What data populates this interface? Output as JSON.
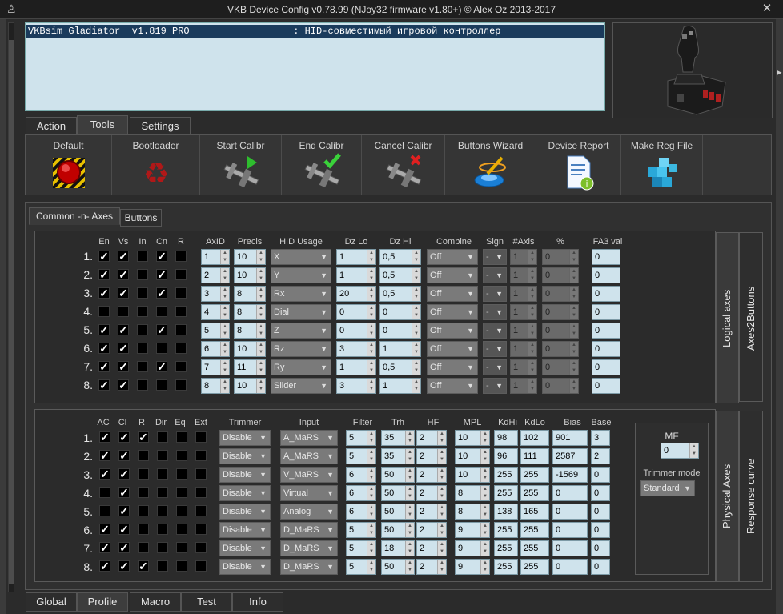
{
  "window": {
    "title": "VKB Device Config v0.78.99 (NJoy32 firmware v1.80+) © Alex Oz 2013-2017",
    "minimize": "—",
    "close": "✕"
  },
  "device": {
    "row": "VKBsim Gladiator  v1.819 PRO                  : HID-совместимый игровой контроллер"
  },
  "top_tabs": [
    "Action",
    "Tools",
    "Settings"
  ],
  "toolbar": [
    {
      "label": "Default",
      "icon": "red-button-icon"
    },
    {
      "label": "Bootloader",
      "icon": "recycle-icon"
    },
    {
      "label": "Start Calibr",
      "icon": "caliper-play-icon"
    },
    {
      "label": "End Calibr",
      "icon": "caliper-check-icon"
    },
    {
      "label": "Cancel Calibr",
      "icon": "caliper-cancel-icon"
    },
    {
      "label": "Buttons Wizard",
      "icon": "wizard-icon"
    },
    {
      "label": "Device Report",
      "icon": "report-icon"
    },
    {
      "label": "Make Reg File",
      "icon": "registry-icon"
    }
  ],
  "sub_tabs": [
    "Common -n- Axes",
    "Buttons"
  ],
  "logical": {
    "side_labels": [
      "Logical axes",
      "Axes2Buttons"
    ],
    "headers": {
      "en": "En",
      "vs": "Vs",
      "in": "In",
      "cn": "Cn",
      "r": "R",
      "axid": "AxID",
      "precis": "Precis",
      "hid": "HID Usage",
      "dzlo": "Dz Lo",
      "dzhi": "Dz Hi",
      "combine": "Combine",
      "sign": "Sign",
      "naxis": "#Axis",
      "pct": "%",
      "fa3": "FA3 val"
    },
    "rows": [
      {
        "n": "1.",
        "en": true,
        "vs": true,
        "in": false,
        "cn": true,
        "r": false,
        "axid": "1",
        "precis": "10",
        "hid": "X",
        "dzlo": "1",
        "dzhi": "0,5",
        "combine": "Off",
        "sign": "-",
        "naxis": "1",
        "pct": "0",
        "fa3": "0"
      },
      {
        "n": "2.",
        "en": true,
        "vs": true,
        "in": false,
        "cn": true,
        "r": false,
        "axid": "2",
        "precis": "10",
        "hid": "Y",
        "dzlo": "1",
        "dzhi": "0,5",
        "combine": "Off",
        "sign": "-",
        "naxis": "1",
        "pct": "0",
        "fa3": "0"
      },
      {
        "n": "3.",
        "en": true,
        "vs": true,
        "in": false,
        "cn": true,
        "r": false,
        "axid": "3",
        "precis": "8",
        "hid": "Rx",
        "dzlo": "20",
        "dzhi": "0,5",
        "combine": "Off",
        "sign": "-",
        "naxis": "1",
        "pct": "0",
        "fa3": "0"
      },
      {
        "n": "4.",
        "en": false,
        "vs": false,
        "in": false,
        "cn": false,
        "r": false,
        "axid": "4",
        "precis": "8",
        "hid": "Dial",
        "dzlo": "0",
        "dzhi": "0",
        "combine": "Off",
        "sign": "-",
        "naxis": "1",
        "pct": "0",
        "fa3": "0"
      },
      {
        "n": "5.",
        "en": true,
        "vs": true,
        "in": false,
        "cn": true,
        "r": false,
        "axid": "5",
        "precis": "8",
        "hid": "Z",
        "dzlo": "0",
        "dzhi": "0",
        "combine": "Off",
        "sign": "-",
        "naxis": "1",
        "pct": "0",
        "fa3": "0"
      },
      {
        "n": "6.",
        "en": true,
        "vs": true,
        "in": false,
        "cn": false,
        "r": false,
        "axid": "6",
        "precis": "10",
        "hid": "Rz",
        "dzlo": "3",
        "dzhi": "1",
        "combine": "Off",
        "sign": "-",
        "naxis": "1",
        "pct": "0",
        "fa3": "0"
      },
      {
        "n": "7.",
        "en": true,
        "vs": true,
        "in": false,
        "cn": true,
        "r": false,
        "axid": "7",
        "precis": "11",
        "hid": "Ry",
        "dzlo": "1",
        "dzhi": "0,5",
        "combine": "Off",
        "sign": "-",
        "naxis": "1",
        "pct": "0",
        "fa3": "0"
      },
      {
        "n": "8.",
        "en": true,
        "vs": true,
        "in": false,
        "cn": false,
        "r": false,
        "axid": "8",
        "precis": "10",
        "hid": "Slider",
        "dzlo": "3",
        "dzhi": "1",
        "combine": "Off",
        "sign": "-",
        "naxis": "1",
        "pct": "0",
        "fa3": "0"
      }
    ]
  },
  "physical": {
    "side_labels": [
      "Physical Axes",
      "Response curve"
    ],
    "headers": {
      "ac": "AC",
      "cl": "Cl",
      "r": "R",
      "dir": "Dir",
      "eq": "Eq",
      "ext": "Ext",
      "trimmer": "Trimmer",
      "input": "Input",
      "filter": "Filter",
      "trh": "Trh",
      "hf": "HF",
      "mpl": "MPL",
      "kdhi": "KdHi",
      "kdlo": "KdLo",
      "bias": "Bias",
      "base": "Base"
    },
    "rows": [
      {
        "n": "1.",
        "ac": true,
        "cl": true,
        "r": true,
        "dir": false,
        "eq": false,
        "ext": false,
        "trimmer": "Disable",
        "input": "A_MaRS",
        "filter": "5",
        "trh": "35",
        "hf": "2",
        "mpl": "10",
        "kdhi": "98",
        "kdlo": "102",
        "bias": "901",
        "base": "3"
      },
      {
        "n": "2.",
        "ac": true,
        "cl": true,
        "r": false,
        "dir": false,
        "eq": false,
        "ext": false,
        "trimmer": "Disable",
        "input": "A_MaRS",
        "filter": "5",
        "trh": "35",
        "hf": "2",
        "mpl": "10",
        "kdhi": "96",
        "kdlo": "111",
        "bias": "2587",
        "base": "2"
      },
      {
        "n": "3.",
        "ac": true,
        "cl": true,
        "r": false,
        "dir": false,
        "eq": false,
        "ext": false,
        "trimmer": "Disable",
        "input": "V_MaRS",
        "filter": "6",
        "trh": "50",
        "hf": "2",
        "mpl": "10",
        "kdhi": "255",
        "kdlo": "255",
        "bias": "-1569",
        "base": "0"
      },
      {
        "n": "4.",
        "ac": false,
        "cl": true,
        "r": false,
        "dir": false,
        "eq": false,
        "ext": false,
        "trimmer": "Disable",
        "input": "Virtual",
        "filter": "6",
        "trh": "50",
        "hf": "2",
        "mpl": "8",
        "kdhi": "255",
        "kdlo": "255",
        "bias": "0",
        "base": "0"
      },
      {
        "n": "5.",
        "ac": false,
        "cl": true,
        "r": false,
        "dir": false,
        "eq": false,
        "ext": false,
        "trimmer": "Disable",
        "input": "Analog",
        "filter": "6",
        "trh": "50",
        "hf": "2",
        "mpl": "8",
        "kdhi": "138",
        "kdlo": "165",
        "bias": "0",
        "base": "0"
      },
      {
        "n": "6.",
        "ac": true,
        "cl": true,
        "r": false,
        "dir": false,
        "eq": false,
        "ext": false,
        "trimmer": "Disable",
        "input": "D_MaRS",
        "filter": "5",
        "trh": "50",
        "hf": "2",
        "mpl": "9",
        "kdhi": "255",
        "kdlo": "255",
        "bias": "0",
        "base": "0"
      },
      {
        "n": "7.",
        "ac": true,
        "cl": true,
        "r": false,
        "dir": false,
        "eq": false,
        "ext": false,
        "trimmer": "Disable",
        "input": "D_MaRS",
        "filter": "5",
        "trh": "18",
        "hf": "2",
        "mpl": "9",
        "kdhi": "255",
        "kdlo": "255",
        "bias": "0",
        "base": "0"
      },
      {
        "n": "8.",
        "ac": true,
        "cl": true,
        "r": true,
        "dir": false,
        "eq": false,
        "ext": false,
        "trimmer": "Disable",
        "input": "D_MaRS",
        "filter": "5",
        "trh": "50",
        "hf": "2",
        "mpl": "9",
        "kdhi": "255",
        "kdlo": "255",
        "bias": "0",
        "base": "0"
      }
    ],
    "mf": {
      "label": "MF",
      "value": "0",
      "trimmer_mode_label": "Trimmer mode",
      "trimmer_mode_value": "Standard"
    }
  },
  "bottom_tabs": [
    "Global",
    "Profile",
    "Macro",
    "Test",
    "Info"
  ]
}
